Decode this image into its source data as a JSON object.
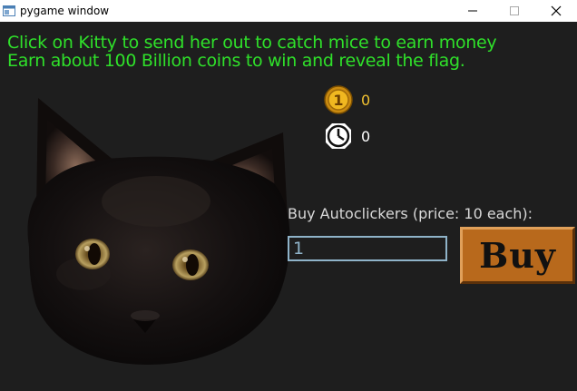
{
  "window": {
    "title": "pygame window",
    "minimize_icon": "minimize-icon",
    "maximize_icon": "maximize-icon",
    "close_icon": "close-icon"
  },
  "instructions": {
    "line1": "Click on Kitty to send her out to catch mice to earn money",
    "line2": "Earn about 100 Billion coins to win and reveal the flag."
  },
  "stats": {
    "coins": {
      "icon": "gold-coin-icon",
      "value": "0"
    },
    "autoclickers": {
      "icon": "clock-icon",
      "value": "0"
    }
  },
  "shop": {
    "label": "Buy Autoclickers (price: 10 each):",
    "quantity_value": "1",
    "buy_label": "Buy"
  },
  "colors": {
    "background": "#1e1e1e",
    "instructions": "#2fe02a",
    "coin_value": "#f2c230",
    "autoclicker_value": "#ffffff",
    "input_border": "#8fb3c9",
    "buy_button": "#b8691c"
  },
  "cat": {
    "icon": "black-cat-image"
  }
}
